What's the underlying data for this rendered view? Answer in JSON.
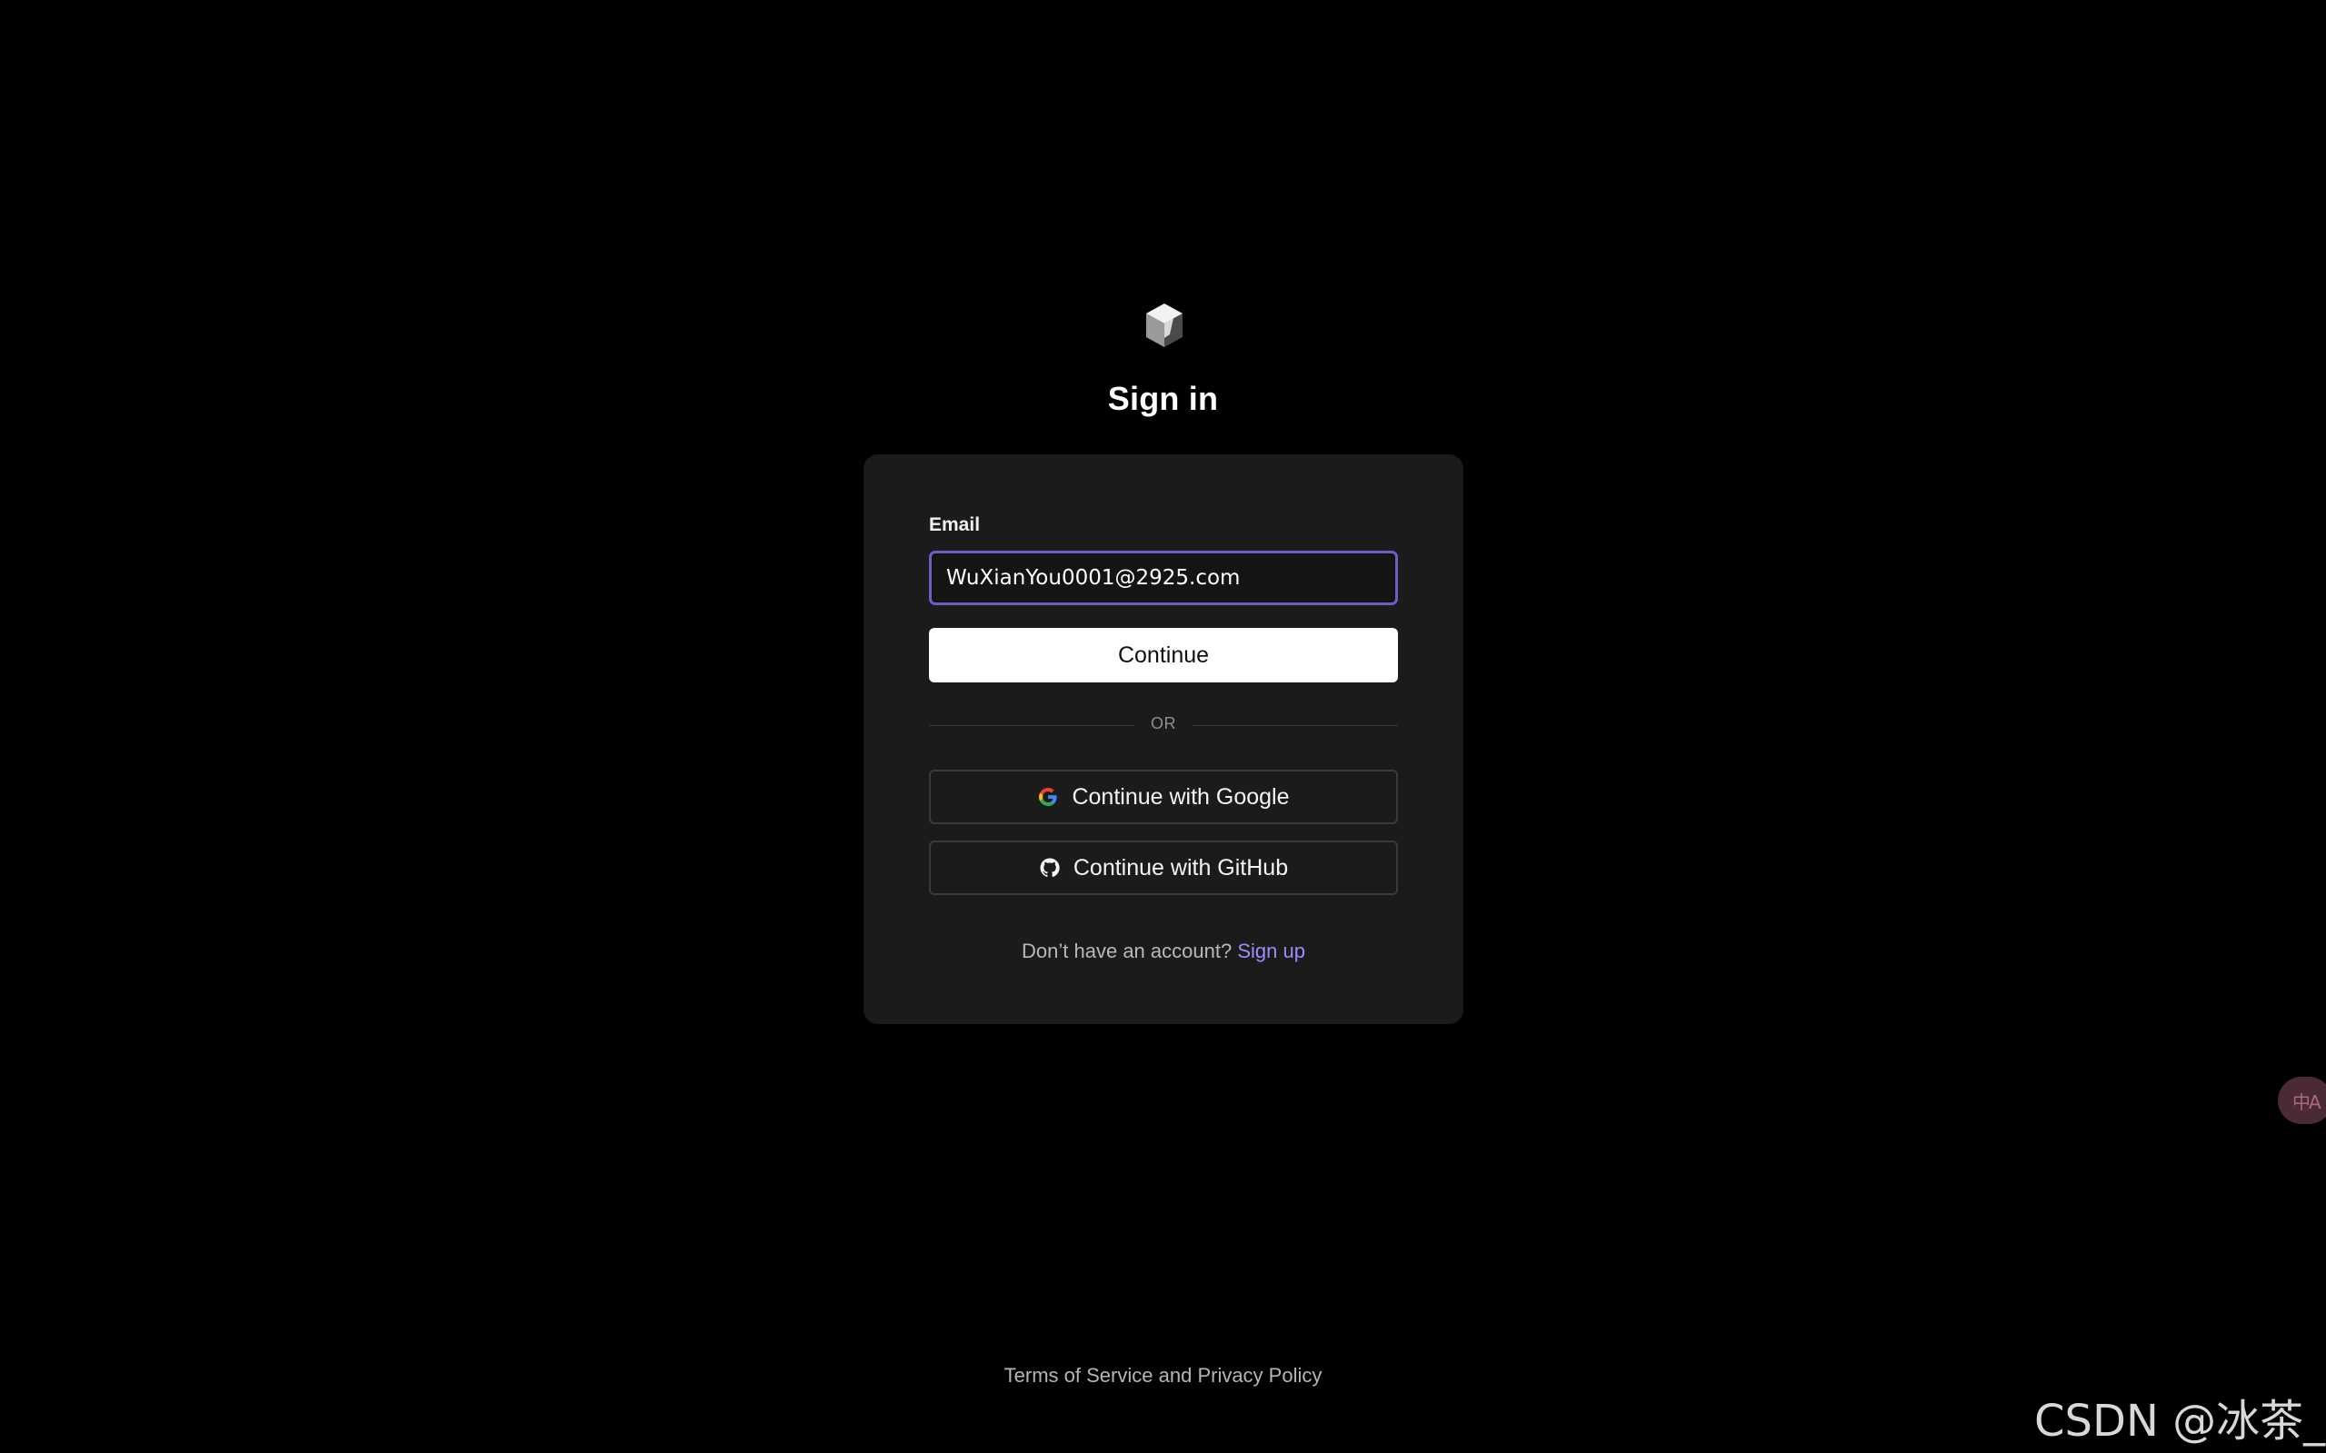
{
  "page": {
    "title": "Sign in"
  },
  "form": {
    "email_label": "Email",
    "email_value": "WuXianYou0001@2925.com",
    "continue_label": "Continue",
    "divider_text": "OR",
    "accent_color": "#6b5fc7"
  },
  "social": {
    "google_label": "Continue with Google",
    "google_icon": "google-icon",
    "github_label": "Continue with GitHub",
    "github_icon": "github-icon"
  },
  "signup": {
    "prompt": "Don’t have an account?",
    "link_label": "Sign up",
    "link_color": "#9b8cff"
  },
  "footer": {
    "terms": "Terms of Service",
    "and": "and",
    "privacy": "Privacy Policy"
  },
  "overlay": {
    "translate_glyph": "中A",
    "watermark": "CSDN @冰茶_"
  },
  "icons": {
    "logo": "cube-logo-icon",
    "translate": "translate-icon"
  }
}
